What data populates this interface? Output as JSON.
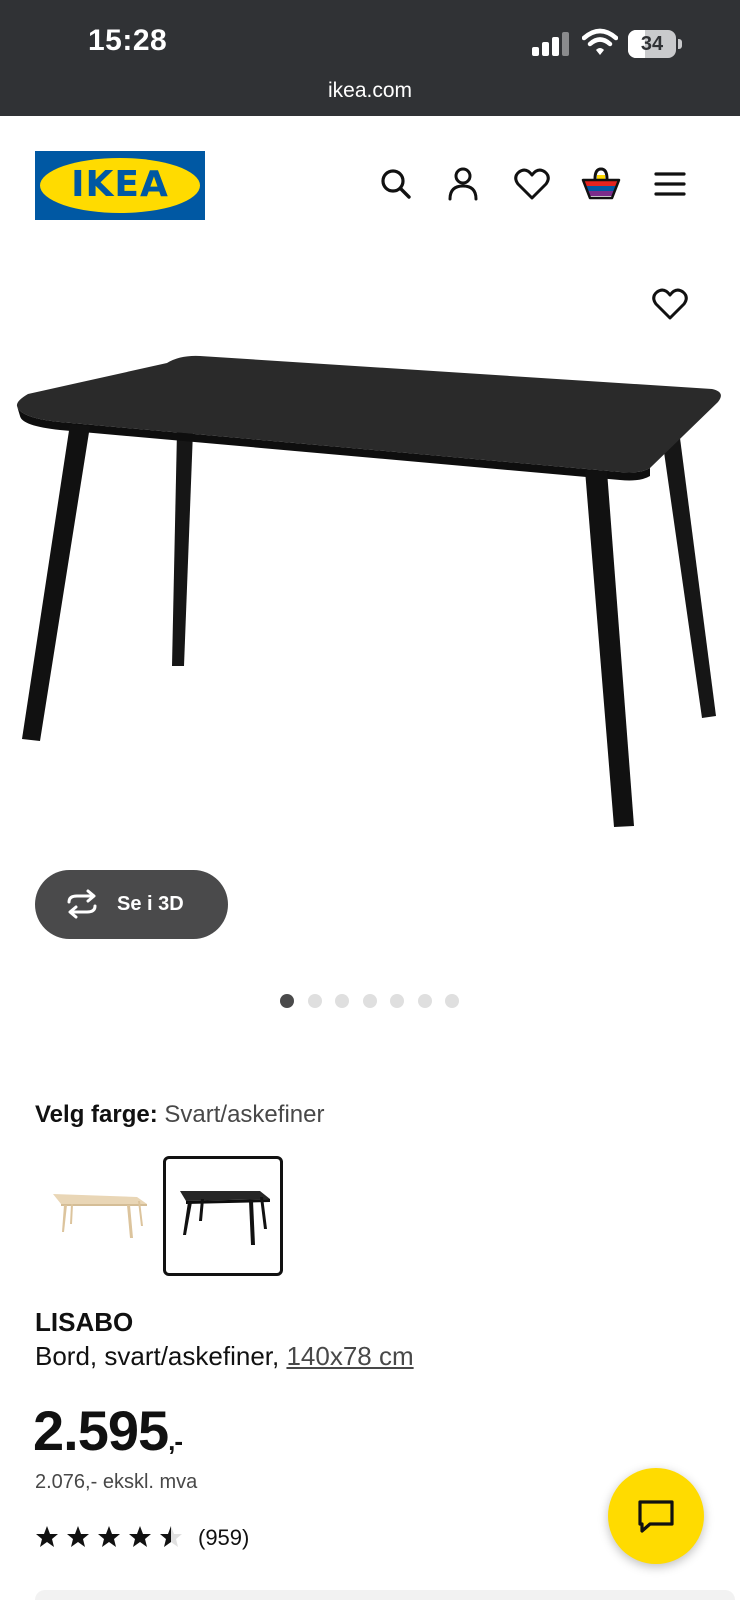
{
  "status_bar": {
    "time": "15:28",
    "battery": "34",
    "url": "ikea.com"
  },
  "header": {
    "logo_text": "IKEA",
    "icons": [
      "search-icon",
      "account-icon",
      "heart-icon",
      "basket-icon",
      "menu-icon"
    ]
  },
  "product_image": {
    "view_3d_label": "Se i 3D",
    "dot_count": 7,
    "active_dot": 0
  },
  "color": {
    "label": "Velg farge:",
    "value": "Svart/askefiner",
    "options": [
      "ash",
      "black"
    ],
    "selected": "black"
  },
  "product": {
    "name": "LISABO",
    "description": "Bord, svart/askefiner, ",
    "size": "140x78 cm",
    "price": "2.595",
    "price_suffix": ",-",
    "price_ex_vat": "2.076,- ekskl. mva",
    "rating_value": 4.5,
    "rating_count": "(959)"
  },
  "colors": {
    "ikea_blue": "#0058a3",
    "ikea_yellow": "#ffdb00",
    "status_bar": "#303235"
  }
}
